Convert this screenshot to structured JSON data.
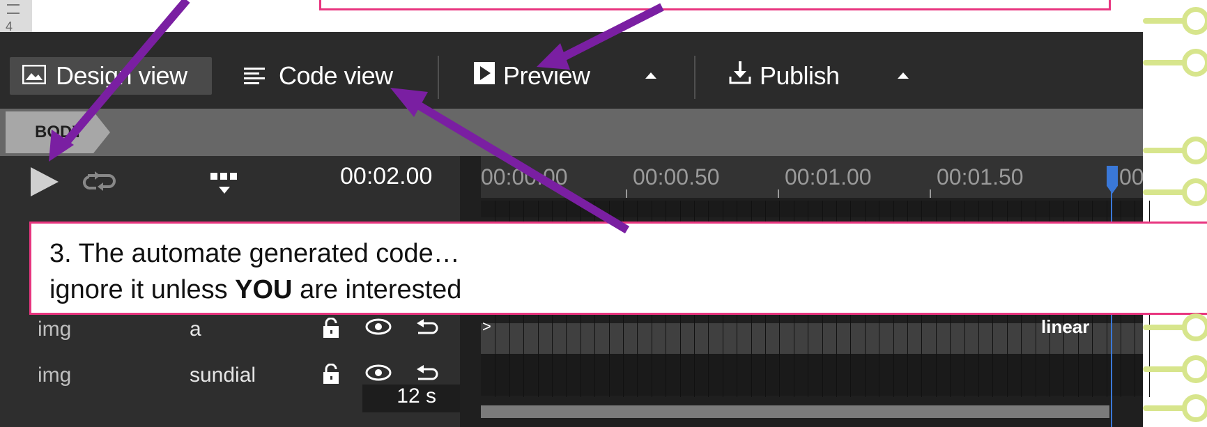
{
  "toolbar": {
    "design_view": "Design view",
    "code_view": "Code view",
    "preview": "Preview",
    "publish": "Publish"
  },
  "breadcrumb": {
    "label": "BODY"
  },
  "timeline": {
    "current_time": "00:02.00",
    "ticks": [
      "00:00.00",
      "00:00.50",
      "00:01.00",
      "00:01.50",
      "00"
    ],
    "duration": "12 s",
    "easing_label": "linear"
  },
  "layers": [
    {
      "type": "img",
      "name": "a"
    },
    {
      "type": "img",
      "name": "sundial"
    }
  ],
  "ruler": {
    "number": "4"
  },
  "callout": {
    "line1": "3. The automate generated code…",
    "line2_pre": "ignore it unless ",
    "line2_bold": "YOU",
    "line2_post": " are interested"
  },
  "colors": {
    "annotation_border": "#e8357f",
    "arrow": "#7a1fa2",
    "playhead": "#3a78d8",
    "connector": "#d7e58c"
  }
}
